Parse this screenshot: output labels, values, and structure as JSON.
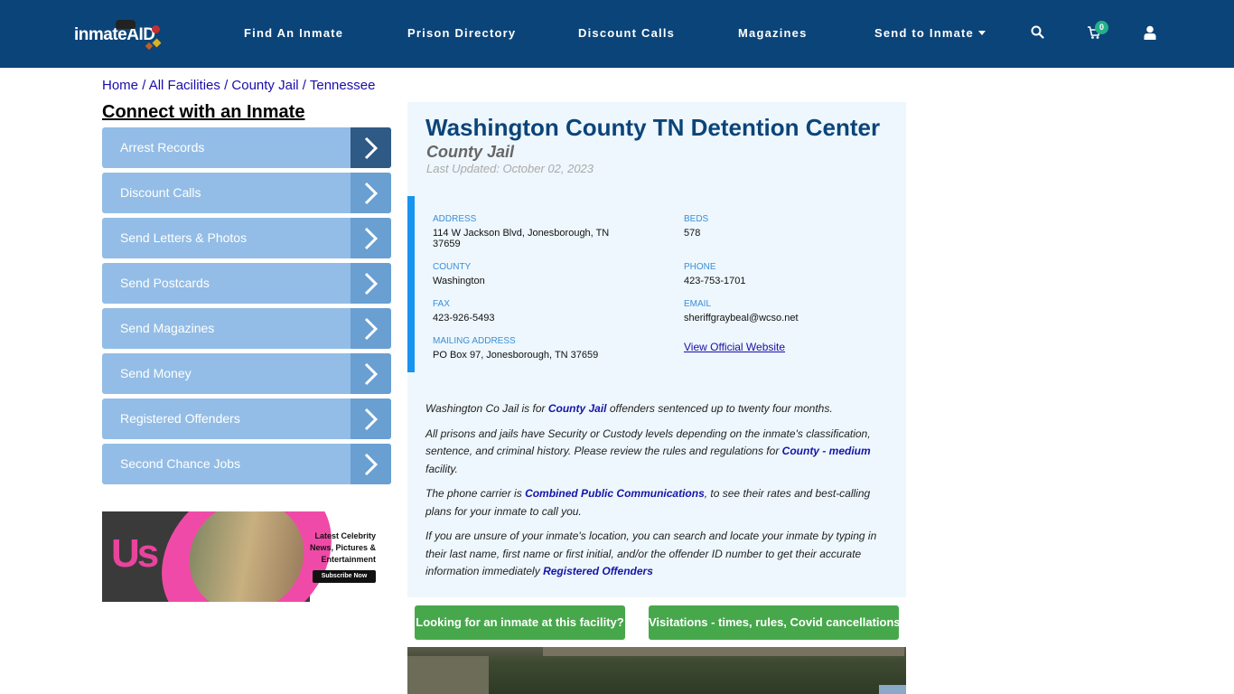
{
  "nav": {
    "logo_text": "inmateAID",
    "links": [
      "Find An Inmate",
      "Prison Directory",
      "Discount Calls",
      "Magazines",
      "Send to Inmate"
    ],
    "cart_count": "0",
    "icons": [
      "search-icon",
      "cart-icon",
      "user-icon"
    ]
  },
  "breadcrumb": {
    "items": [
      "Home",
      "All Facilities",
      "County Jail",
      "Tennessee"
    ],
    "separator": "/"
  },
  "sidebar": {
    "title": "Connect with an Inmate",
    "items": [
      {
        "label": "Arrest Records"
      },
      {
        "label": "Discount Calls"
      },
      {
        "label": "Send Letters & Photos"
      },
      {
        "label": "Send Postcards"
      },
      {
        "label": "Send Magazines"
      },
      {
        "label": "Send Money"
      },
      {
        "label": "Registered Offenders"
      },
      {
        "label": "Second Chance Jobs"
      }
    ]
  },
  "ad": {
    "brand": "Us",
    "line1": "Latest Celebrity",
    "line2": "News, Pictures &",
    "line3": "Entertainment",
    "button": "Subscribe Now"
  },
  "facility": {
    "title": "Washington County TN Detention Center",
    "type": "County Jail",
    "last_updated": "Last Updated: October 02, 2023",
    "info": {
      "address_label": "ADDRESS",
      "address": "114 W Jackson Blvd, Jonesborough, TN 37659",
      "beds_label": "BEDS",
      "beds": "578",
      "county_label": "COUNTY",
      "county": "Washington",
      "phone_label": "PHONE",
      "phone": "423-753-1701",
      "fax_label": "FAX",
      "fax": "423-926-5493",
      "email_label": "EMAIL",
      "email": "sheriffgraybeal@wcso.net",
      "mailing_label": "MAILING ADDRESS",
      "mailing": "PO Box 97, Jonesborough, TN 37659",
      "website_link": "View Official Website"
    },
    "description": {
      "p1_pre": "Washington Co Jail is for ",
      "p1_link": "County Jail",
      "p1_post": " offenders sentenced up to twenty four months.",
      "p2_pre": "All prisons and jails have Security or Custody levels depending on the inmate's classification, sentence, and criminal history. Please review the rules and regulations for ",
      "p2_link": "County - medium",
      "p2_post": " facility.",
      "p3_pre": "The phone carrier is ",
      "p3_link": "Combined Public Communications",
      "p3_post": ", to see their rates and best-calling plans for your inmate to call you.",
      "p4_pre": "If you are unsure of your inmate's location, you can search and locate your inmate by typing in their last name, first name or first initial, and/or the offender ID number to get their accurate information immediately ",
      "p4_link": "Registered Offenders"
    },
    "buttons": {
      "find_inmate": "Looking for an inmate at this facility?",
      "visitation": "Visitations - times, rules, Covid cancellations"
    }
  },
  "colors": {
    "navbar": "#0b4479",
    "sidebar_item": "#93bde6",
    "sidebar_arrow": "#6a9fd2",
    "accent_green": "#47a84b",
    "info_border": "#1793f0"
  }
}
